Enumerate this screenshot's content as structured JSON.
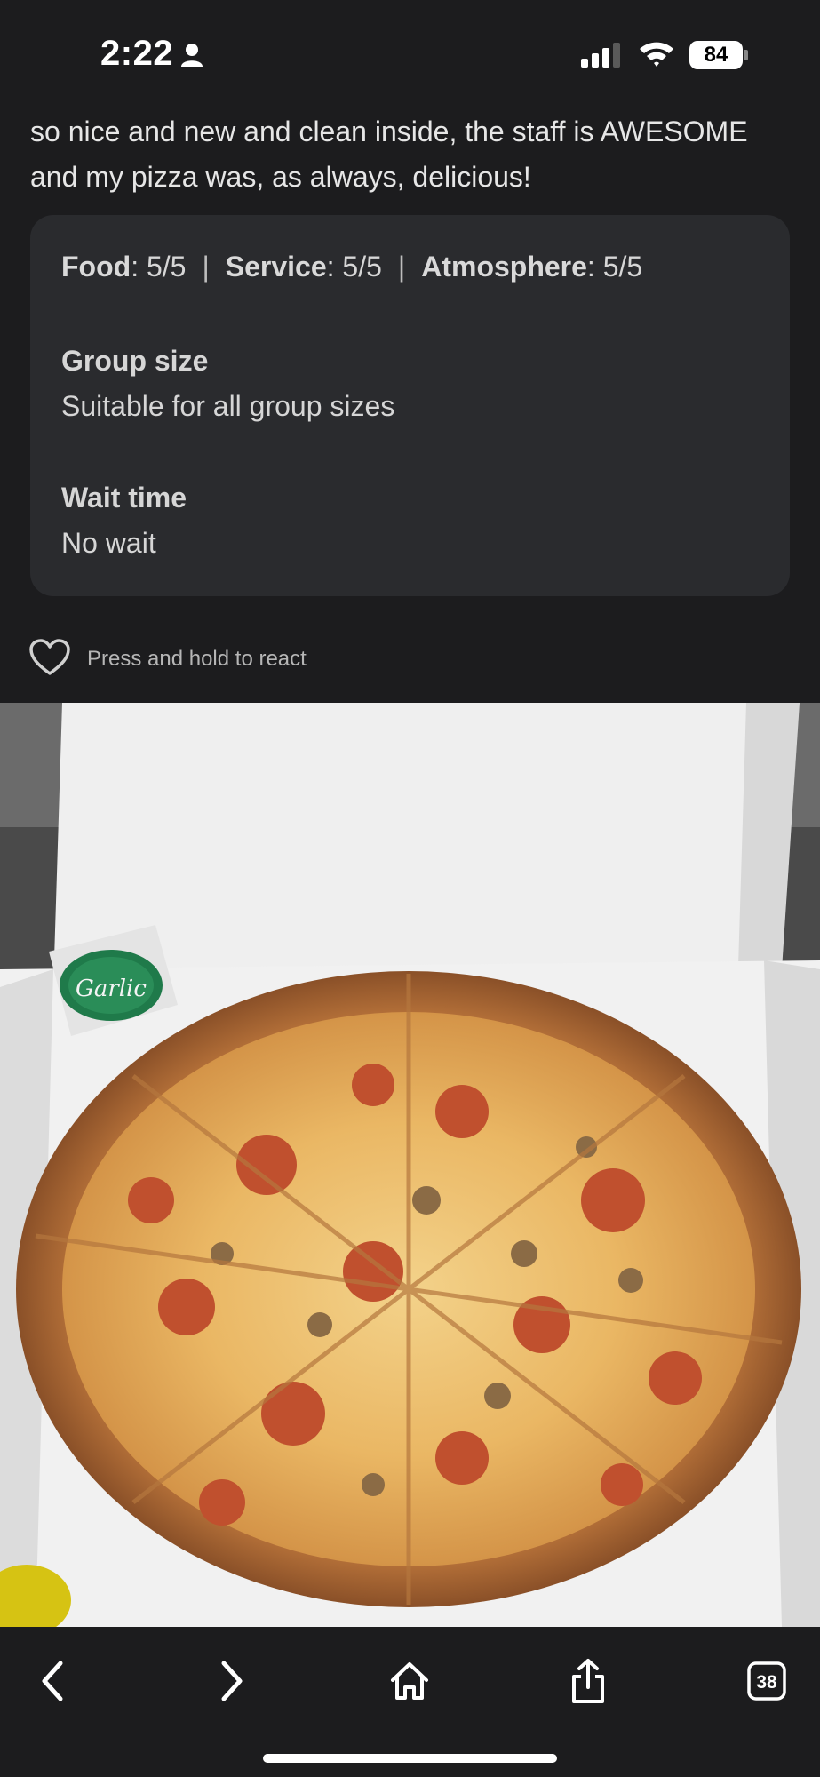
{
  "status_bar": {
    "time": "2:22",
    "battery": "84"
  },
  "review": {
    "text": "so nice and new and clean inside, the staff is AWESOME and my pizza was, as always, delicious!"
  },
  "ratings": {
    "food_label": "Food",
    "food_value": "5/5",
    "service_label": "Service",
    "service_value": "5/5",
    "atmosphere_label": "Atmosphere",
    "atmosphere_value": "5/5",
    "separator": "|"
  },
  "attributes": [
    {
      "label": "Group size",
      "value": "Suitable for all group sizes"
    },
    {
      "label": "Wait time",
      "value": "No wait"
    }
  ],
  "react": {
    "label": "Press and hold to react"
  },
  "photo": {
    "cup_label": "Garlic"
  },
  "toolbar": {
    "tabs_count": "38"
  },
  "colors": {
    "background": "#1c1c1e",
    "card": "#2a2b2e",
    "text": "#e6e6e6"
  }
}
